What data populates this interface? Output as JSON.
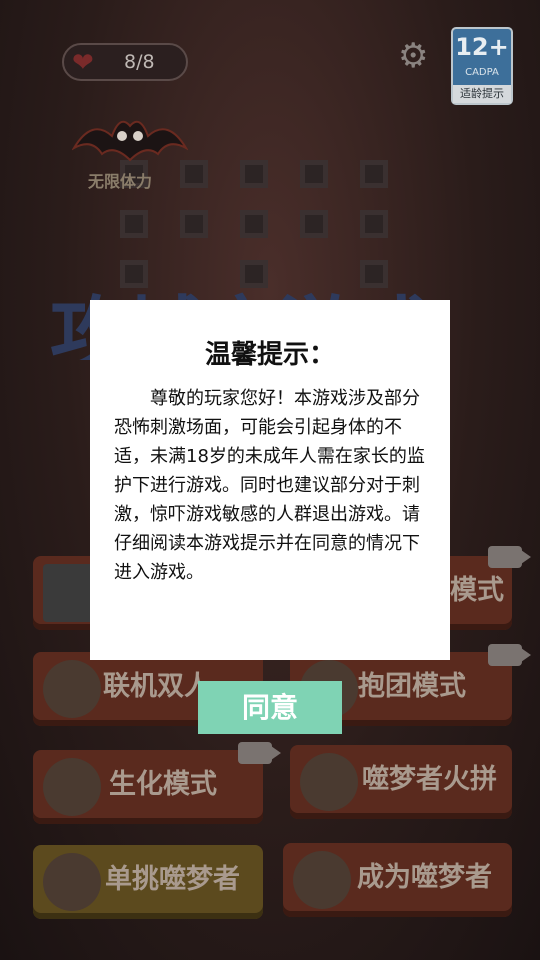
{
  "hud": {
    "health": "8/8",
    "health_icon": "heart-icon",
    "settings_icon": "gear-icon",
    "age_rating": {
      "number": "12+",
      "org": "CADPA",
      "tip": "适龄提示"
    },
    "bonus_label": "无限体力"
  },
  "background": {
    "title_text": "攻城夜游戏"
  },
  "modes": [
    {
      "label": "模式"
    },
    {
      "label": "联机双人"
    },
    {
      "label": "抱团模式"
    },
    {
      "label": "生化模式"
    },
    {
      "label": "噬梦者火拼"
    },
    {
      "label": "单挑噬梦者"
    },
    {
      "label": "成为噬梦者"
    }
  ],
  "dialog": {
    "title": "温馨提示：",
    "body": "尊敬的玩家您好！本游戏涉及部分恐怖刺激场面，可能会引起身体的不适，未满18岁的未成年人需在家长的监护下进行游戏。同时也建议部分对于刺激，惊吓游戏敏感的人群退出游戏。请仔细阅读本游戏提示并在同意的情况下进入游戏。",
    "agree_label": "同意"
  },
  "colors": {
    "agree_button": "#7fd3b4",
    "dialog_bg": "#ffffff",
    "age_badge": "#3d6f9a"
  }
}
